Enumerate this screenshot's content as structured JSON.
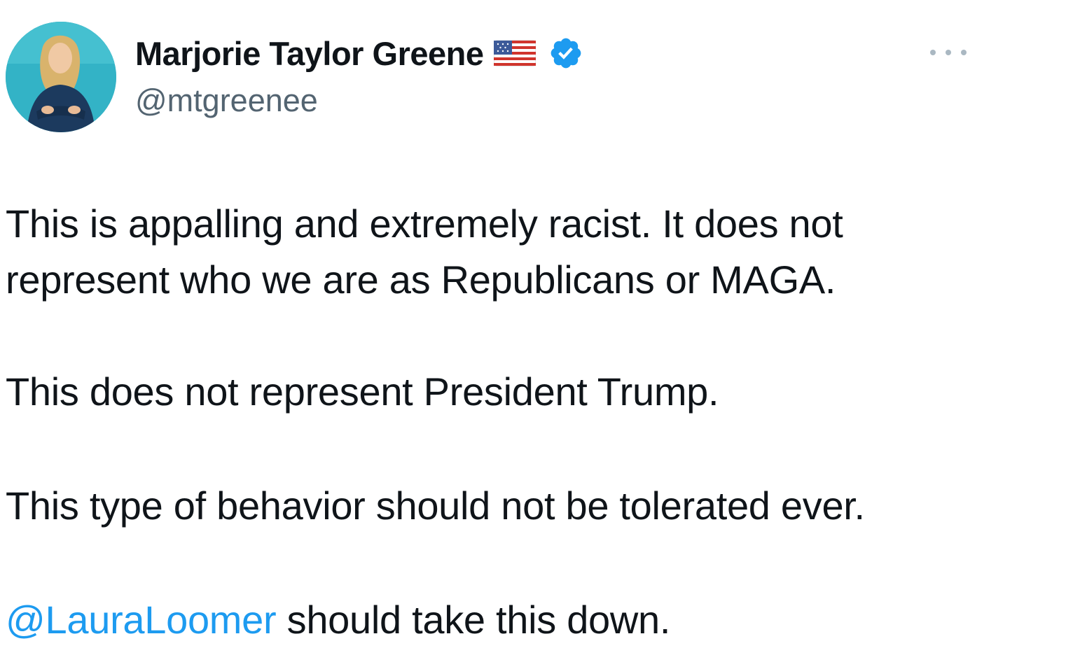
{
  "author": {
    "display_name": "Marjorie Taylor Greene",
    "handle": "@mtgreenee",
    "avatar_icon": "profile-photo",
    "flag_icon": "us-flag-emoji",
    "verified_icon": "verified-badge",
    "verified_color": "#1d9bf0"
  },
  "menu": {
    "icon": "more-options-icon"
  },
  "tweet": {
    "line1": "This is appalling and extremely racist.  It does not",
    "line2": "represent who we are as Republicans or MAGA.",
    "para2": "This does not represent President Trump.",
    "para3": "This type of behavior should not be tolerated ever.",
    "mention": "@LauraLoomer",
    "para4_rest": " should take this down."
  },
  "colors": {
    "text": "#0f1419",
    "secondary": "#536471",
    "link": "#1d9bf0"
  }
}
